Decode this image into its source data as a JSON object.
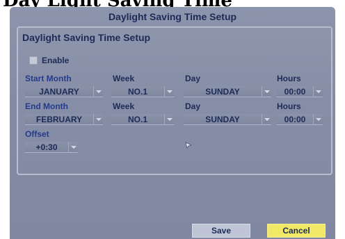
{
  "page_title": "Day Light Saving Time",
  "screen": {
    "title": "Daylight Saving Time Setup",
    "section_title": "Daylight Saving Time Setup",
    "enable_label": "Enable",
    "enable_checked": false
  },
  "start": {
    "month_label": "Start Month",
    "week_label": "Week",
    "day_label": "Day",
    "hours_label": "Hours",
    "month_value": "JANUARY",
    "week_value": "NO.1",
    "day_value": "SUNDAY",
    "hours_value": "00:00"
  },
  "end": {
    "month_label": "End Month",
    "week_label": "Week",
    "day_label": "Day",
    "hours_label": "Hours",
    "month_value": "FEBRUARY",
    "week_value": "NO.1",
    "day_value": "SUNDAY",
    "hours_value": "00:00"
  },
  "offset": {
    "label": "Offset",
    "value": "+0:30"
  },
  "buttons": {
    "save": "Save",
    "cancel": "Cancel"
  },
  "colors": {
    "background": "#848ca6",
    "text": "#1d2a56",
    "cancel_button": "#f0e866",
    "save_button": "#bfc5d6"
  },
  "icons": {
    "cursor": "mouse-pointer-icon",
    "dropdown": "chevron-down-icon"
  }
}
